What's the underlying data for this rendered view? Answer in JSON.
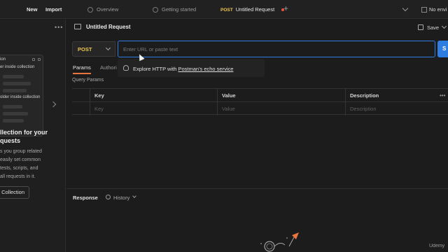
{
  "topbar": {
    "new_label": "New",
    "import_label": "Import",
    "tabs": [
      {
        "label": "Overview"
      },
      {
        "label": "Getting started"
      },
      {
        "method": "POST",
        "label": "Untitled Request"
      }
    ],
    "environment": "No envi"
  },
  "sidebar": {
    "illustration": {
      "collection_label": "ion",
      "folder_label": "er inside collection",
      "subfolder_label": "older inside collection"
    },
    "title_line1": "llection for your",
    "title_line2": "quests",
    "body": [
      "s you group related",
      "easily set common",
      "tests, scripts, and",
      "all requests in it."
    ],
    "button_label": "Collection"
  },
  "request": {
    "title": "Untitled Request",
    "save_label": "Save",
    "method": "POST",
    "url_placeholder": "Enter URL or paste text",
    "send_label": "S",
    "tabs": [
      {
        "label": "Params"
      },
      {
        "label": "Authori"
      }
    ],
    "section_label": "Query Params",
    "params_columns": [
      "Key",
      "Value",
      "Description"
    ],
    "params_placeholders": [
      "Key",
      "Value",
      "Description"
    ]
  },
  "suggestion": {
    "prefix": "Explore HTTP with ",
    "link": "Postman's echo service"
  },
  "response": {
    "title": "Response",
    "history_label": "History"
  },
  "watermark": "Udemy"
}
